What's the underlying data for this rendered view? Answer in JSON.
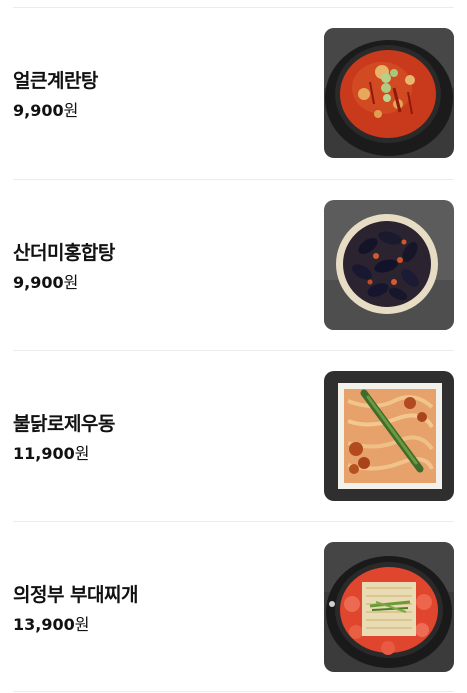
{
  "menu": {
    "items": [
      {
        "name": "얼큰계란탕",
        "price": "9,900",
        "currency": "원",
        "image": "spicy-egg-stew-photo"
      },
      {
        "name": "산더미홍합탕",
        "price": "9,900",
        "currency": "원",
        "image": "mussel-stew-photo"
      },
      {
        "name": "불닭로제우동",
        "price": "11,900",
        "currency": "원",
        "image": "rose-udon-photo"
      },
      {
        "name": "의정부 부대찌개",
        "price": "13,900",
        "currency": "원",
        "image": "army-stew-photo"
      }
    ]
  }
}
